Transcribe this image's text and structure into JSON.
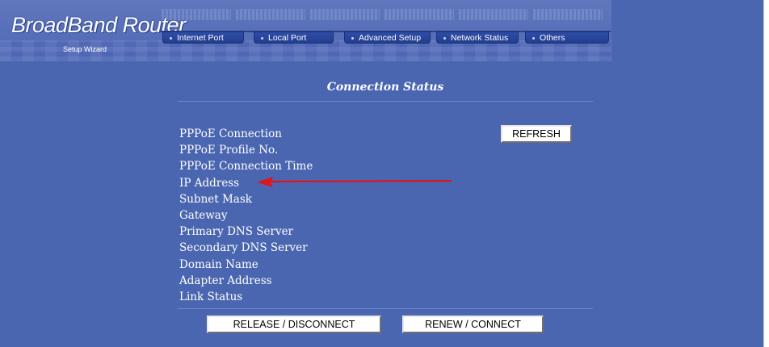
{
  "header": {
    "logo_text": "BroadBand Router",
    "subtitle": "Setup Wizard",
    "nav_tabs": [
      {
        "label": "Internet Port"
      },
      {
        "label": "Local Port"
      },
      {
        "label": "Advanced Setup"
      },
      {
        "label": "Network Status"
      },
      {
        "label": "Others"
      }
    ]
  },
  "main": {
    "title": "Connection Status",
    "refresh_label": "REFRESH",
    "fields": [
      "PPPoE Connection",
      "PPPoE Profile No.",
      "PPPoE Connection Time",
      "IP Address",
      "Subnet Mask",
      "Gateway",
      "Primary DNS Server",
      "Secondary DNS Server",
      "Domain Name",
      "Adapter Address",
      "Link Status"
    ],
    "release_label": "RELEASE / DISCONNECT",
    "renew_label": "RENEW / CONNECT"
  },
  "annotation": {
    "arrow_color": "#e0141a",
    "points_to": "IP Address"
  },
  "colors": {
    "background": "#4a66b1",
    "tab": "#2a47a0",
    "text": "#ffffff"
  }
}
